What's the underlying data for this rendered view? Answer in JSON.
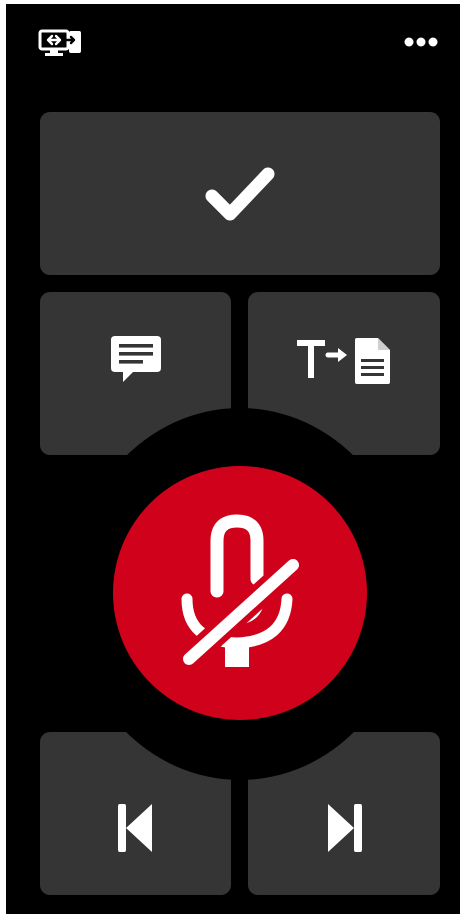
{
  "topbar": {
    "left_icon": "screen-share-icon",
    "right_icon": "more-options-icon"
  },
  "actions": {
    "confirm": {
      "icon": "checkmark-icon"
    },
    "comment": {
      "icon": "comment-icon"
    },
    "dictate_to_document": {
      "icon": "text-to-document-icon"
    },
    "previous": {
      "icon": "skip-previous-icon"
    },
    "next": {
      "icon": "skip-next-icon"
    }
  },
  "microphone": {
    "state": "muted",
    "icon": "microphone-muted-icon"
  },
  "colors": {
    "background": "#000000",
    "tile": "#353535",
    "icon": "#ffffff",
    "mic_button": "#d0021b"
  }
}
